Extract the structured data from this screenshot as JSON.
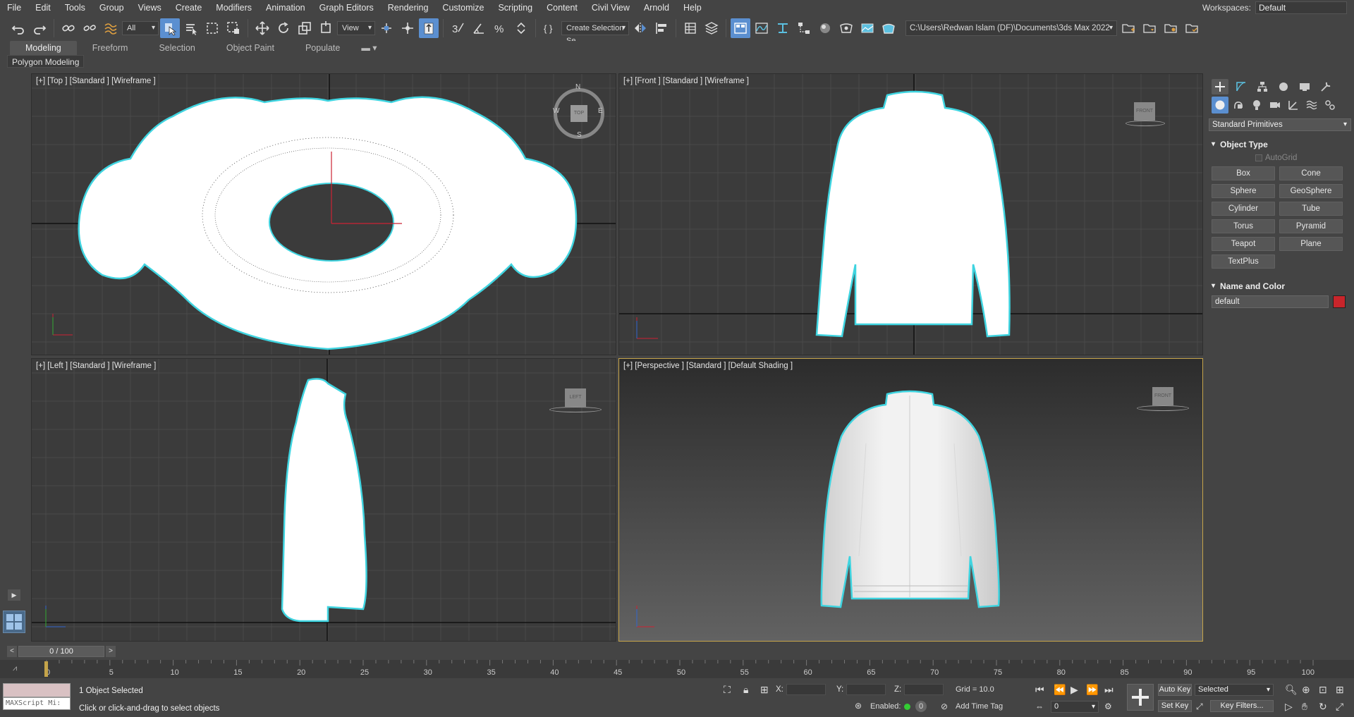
{
  "menu": [
    "File",
    "Edit",
    "Tools",
    "Group",
    "Views",
    "Create",
    "Modifiers",
    "Animation",
    "Graph Editors",
    "Rendering",
    "Customize",
    "Scripting",
    "Content",
    "Civil View",
    "Arnold",
    "Help"
  ],
  "workspaces": {
    "label": "Workspaces:",
    "value": "Default"
  },
  "toolbar": {
    "selection_filter": "All",
    "ref_coord": "View",
    "named_selection": "Create Selection Se",
    "project_path": "C:\\Users\\Redwan Islam (DF)\\Documents\\3ds Max 2022",
    "icons": [
      "undo-icon",
      "redo-icon",
      "link-icon",
      "unlink-icon",
      "bind-spacewarp-icon",
      "select-object-icon",
      "select-by-name-icon",
      "rect-region-icon",
      "window-crossing-icon",
      "select-move-icon",
      "select-rotate-icon",
      "select-scale-icon",
      "placement-icon",
      "use-pivot-icon",
      "snap-3d-icon",
      "angle-snap-icon",
      "percent-snap-icon",
      "spinner-snap-icon",
      "edit-named-sets-icon",
      "mirror-icon",
      "align-icon",
      "scene-explorer-icon",
      "layer-explorer-icon",
      "toggle-ribbon-icon",
      "curve-editor-icon",
      "schematic-view-icon",
      "material-editor-icon",
      "render-setup-icon",
      "rendered-frame-icon",
      "render-production-icon"
    ]
  },
  "ribbon": {
    "tabs": [
      "Modeling",
      "Freeform",
      "Selection",
      "Object Paint",
      "Populate"
    ],
    "active_tab": "Modeling",
    "panel_label": "Polygon Modeling"
  },
  "viewports": {
    "top": {
      "label": "[+] [Top ] [Standard ] [Wireframe ]",
      "cube": "TOP",
      "compass": [
        "N",
        "E",
        "S",
        "W"
      ]
    },
    "front": {
      "label": "[+] [Front ] [Standard ] [Wireframe ]",
      "cube": "FRONT"
    },
    "left": {
      "label": "[+] [Left ] [Standard ] [Wireframe ]",
      "cube": "LEFT"
    },
    "perspective": {
      "label": "[+] [Perspective ] [Standard ] [Default Shading ]",
      "cube": "FRONT"
    }
  },
  "command_panel": {
    "category": "Standard Primitives",
    "object_type_title": "Object Type",
    "autogrid": "AutoGrid",
    "primitives": [
      "Box",
      "Cone",
      "Sphere",
      "GeoSphere",
      "Cylinder",
      "Tube",
      "Torus",
      "Pyramid",
      "Teapot",
      "Plane",
      "TextPlus"
    ],
    "name_color_title": "Name and Color",
    "object_name": "default",
    "object_color": "#c8252b"
  },
  "time_slider": {
    "frame": "0 / 100",
    "prev": "<",
    "next": ">"
  },
  "track_ticks": [
    "0",
    "5",
    "10",
    "15",
    "20",
    "25",
    "30",
    "35",
    "40",
    "45",
    "50",
    "55",
    "60",
    "65",
    "70",
    "75",
    "80",
    "85",
    "90",
    "95",
    "100"
  ],
  "status": {
    "maxscript": "MAXScript Mi:",
    "selection": "1 Object Selected",
    "prompt": "Click or click-and-drag to select objects",
    "x_label": "X:",
    "y_label": "Y:",
    "z_label": "Z:",
    "grid": "Grid = 10.0",
    "enabled_label": "Enabled:",
    "enabled_count": "0",
    "add_time_tag": "Add Time Tag",
    "auto_key": "Auto Key",
    "set_key": "Set Key",
    "key_mode": "Selected",
    "key_filters": "Key Filters...",
    "current_frame": "0"
  },
  "colors": {
    "accent": "#5b8fd0",
    "active_viewport": "#c5a44a",
    "selection_outline": "#3fd4e0"
  }
}
